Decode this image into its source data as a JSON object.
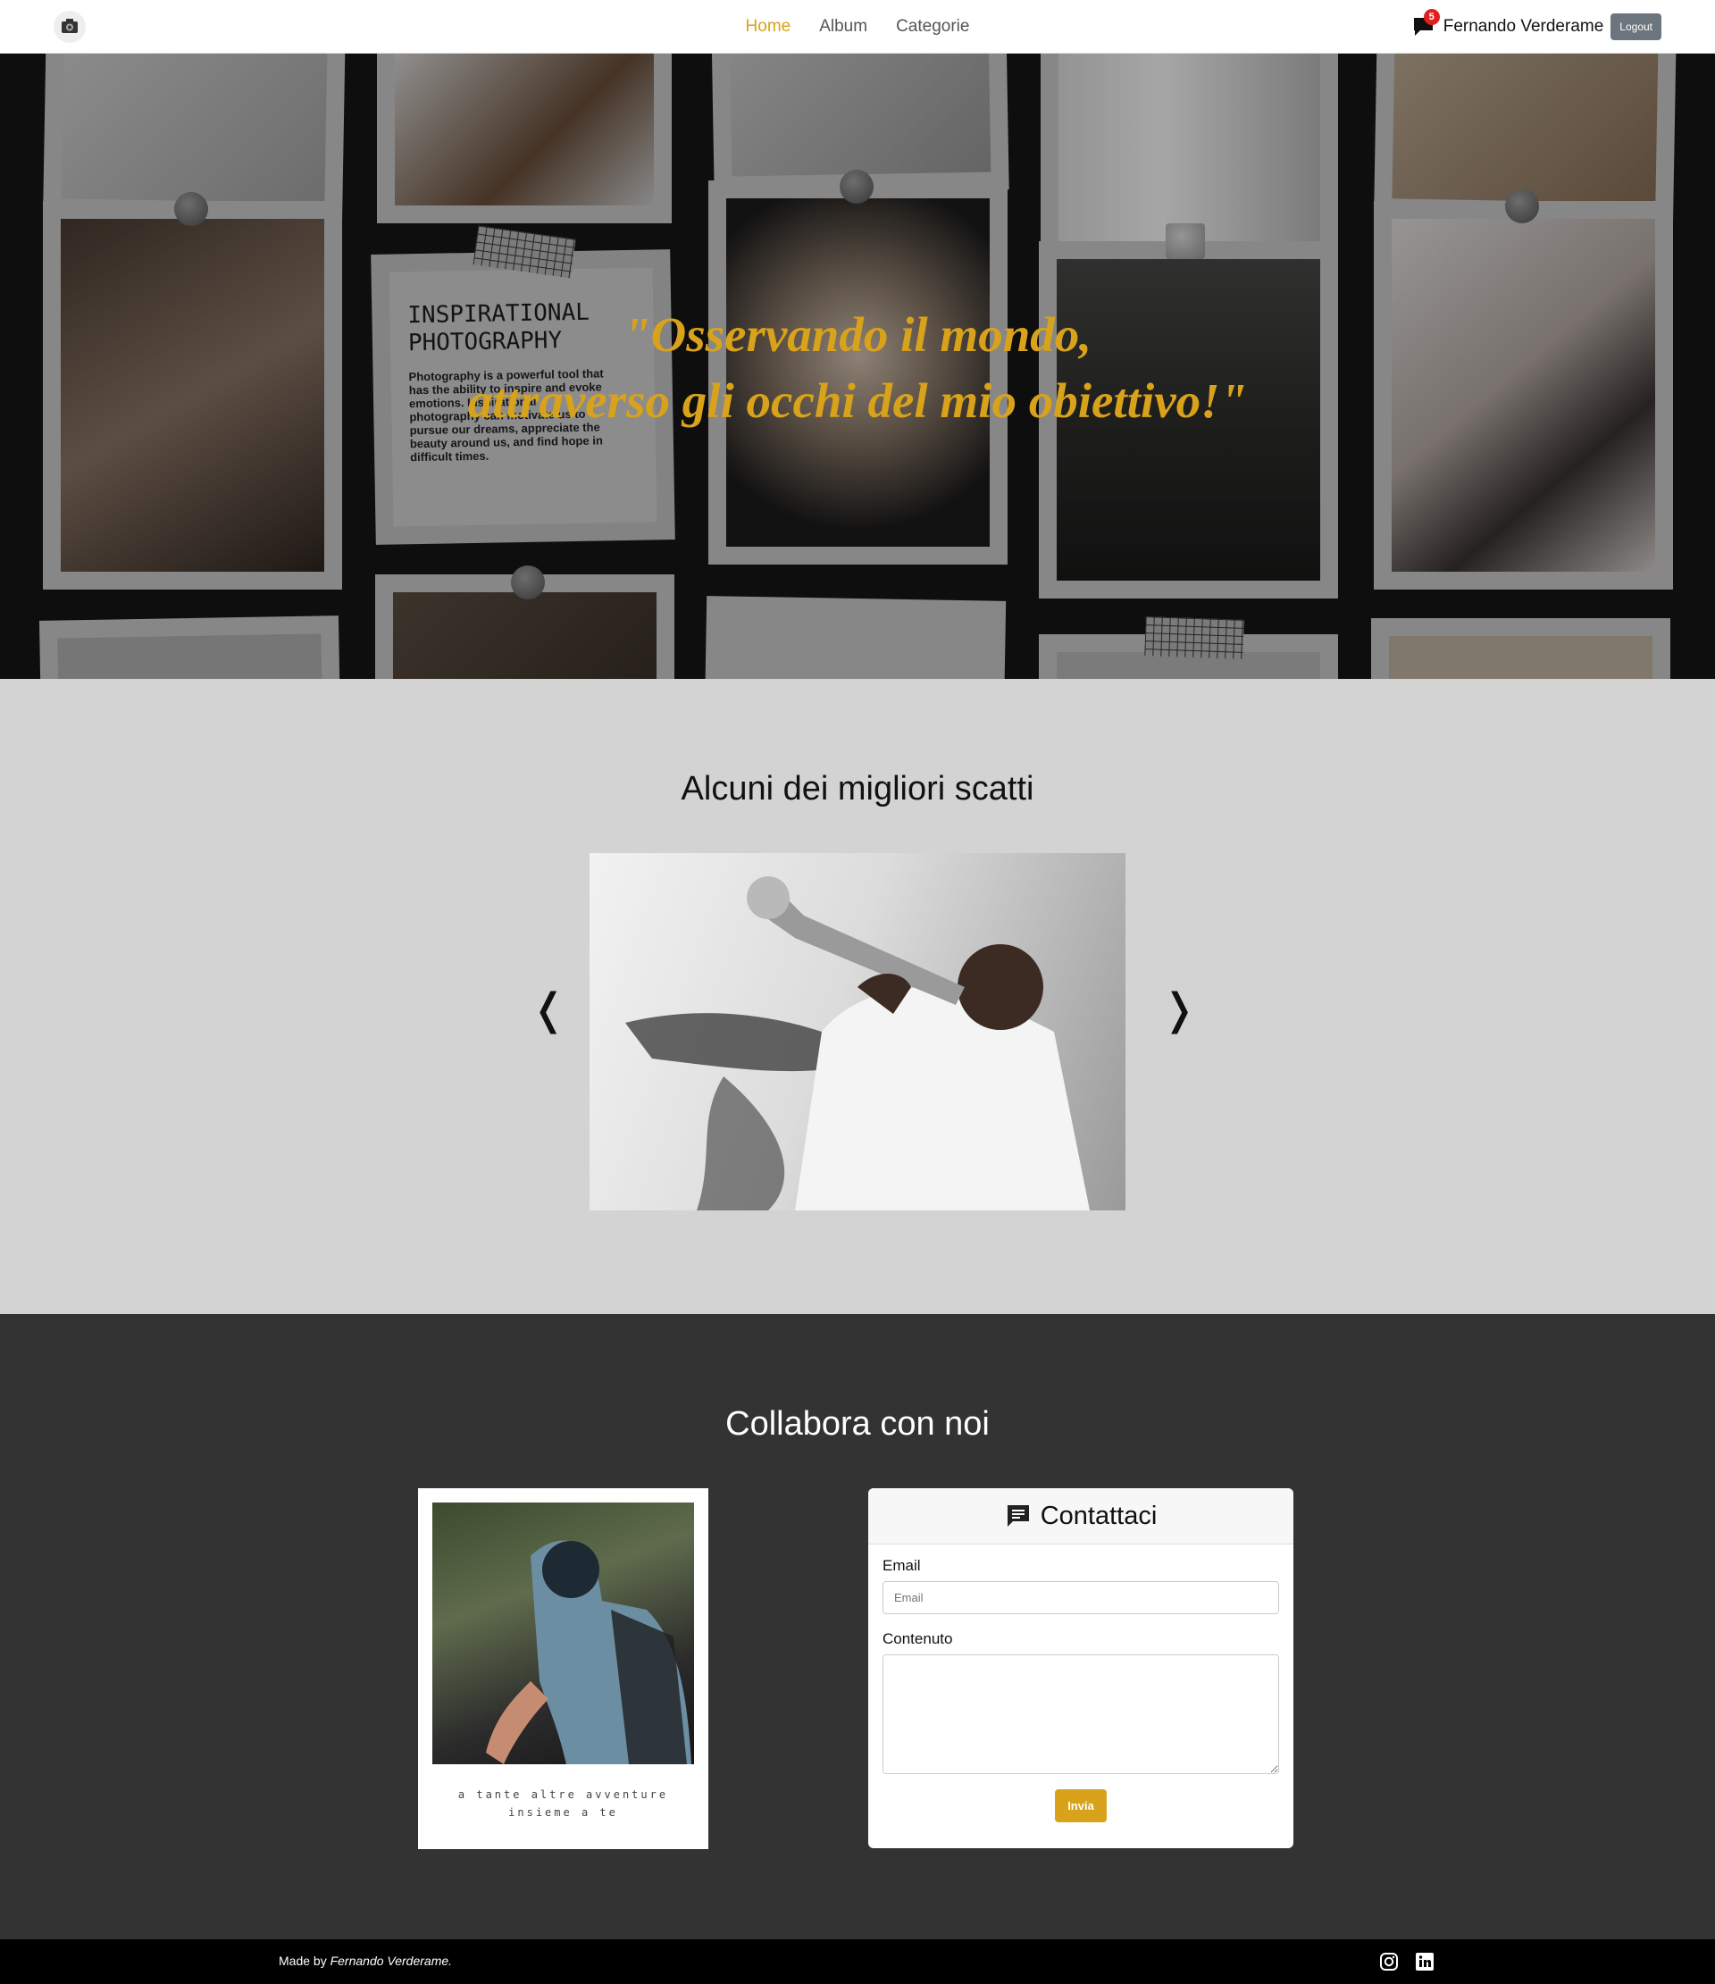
{
  "navbar": {
    "logo_icon": "camera-logo-icon",
    "links": [
      {
        "label": "Home",
        "active": true
      },
      {
        "label": "Album",
        "active": false
      },
      {
        "label": "Categorie",
        "active": false
      }
    ],
    "notification_count": "5",
    "user_name": "Fernando Verderame",
    "logout_label": "Logout"
  },
  "hero": {
    "quote_line1": "\"Osservando il mondo,",
    "quote_line2": "attraverso gli occhi del mio obiettivo!\"",
    "note_title_line1": "INSPIRATIONAL",
    "note_title_line2": "PHOTOGRAPHY",
    "note_body": "Photography is a powerful tool that has the ability to inspire and evoke emotions. Inspirational photography can motivate us to pursue our dreams, appreciate the beauty around us, and find hope in difficult times.",
    "quote_color": "#d9a21b"
  },
  "best_shots": {
    "title": "Alcuni dei migliori scatti",
    "prev_icon": "chevron-left-icon",
    "next_icon": "chevron-right-icon",
    "prev_arrow": "❬",
    "next_arrow": "❭"
  },
  "collab": {
    "title": "Collabora con noi",
    "polaroid_caption_line1": "a tante altre avventure",
    "polaroid_caption_line2": "insieme a te",
    "contact": {
      "icon": "chat-icon",
      "title": "Contattaci",
      "email_label": "Email",
      "email_placeholder": "Email",
      "content_label": "Contenuto",
      "send_label": "Invia"
    }
  },
  "footer": {
    "made_by": "Made by",
    "author": "Fernando Verderame.",
    "social_icons": [
      "instagram-icon",
      "linkedin-icon"
    ]
  },
  "colors": {
    "accent": "#d9a21b",
    "hero_bg": "#161616",
    "best_bg": "#d3d3d3",
    "collab_bg": "#333333",
    "footer_bg": "#000000",
    "badge": "#e02020",
    "logout_bg": "#6c757d"
  }
}
